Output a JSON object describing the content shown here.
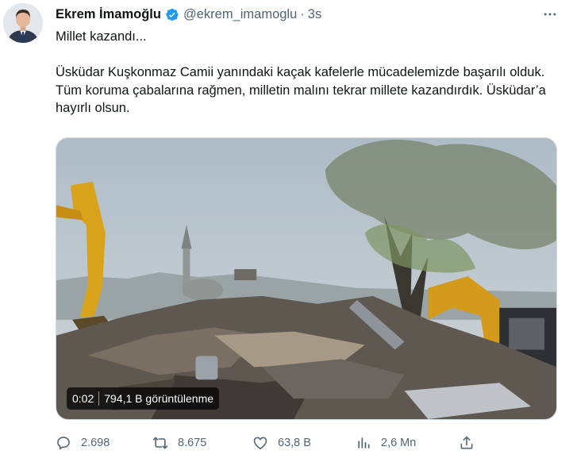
{
  "user": {
    "name": "Ekrem İmamoğlu",
    "handle": "@ekrem_imamoglu",
    "separator": "·",
    "time": "3s",
    "verified_icon": "verified-badge-icon",
    "more_icon": "more-horizontal-icon"
  },
  "tweet": {
    "line1": "Millet kazandı...",
    "body": "Üsküdar Kuşkonmaz Camii yanındaki kaçak kafelerle mücadelemizde başarılı olduk. Tüm koruma çabalarına rağmen, milletin malını tekrar millete kazandırdık. Üsküdar’a hayırlı olsun."
  },
  "media": {
    "duration": "0:02",
    "views_overlay": "794,1 B görüntülenme"
  },
  "actions": {
    "replies": "2.698",
    "retweets": "8.675",
    "likes": "63,8 B",
    "views": "2,6 Mn"
  },
  "colors": {
    "text_primary": "#0f1419",
    "text_secondary": "#536471",
    "verified_blue": "#1d9bf0",
    "border": "#cfd9de"
  }
}
